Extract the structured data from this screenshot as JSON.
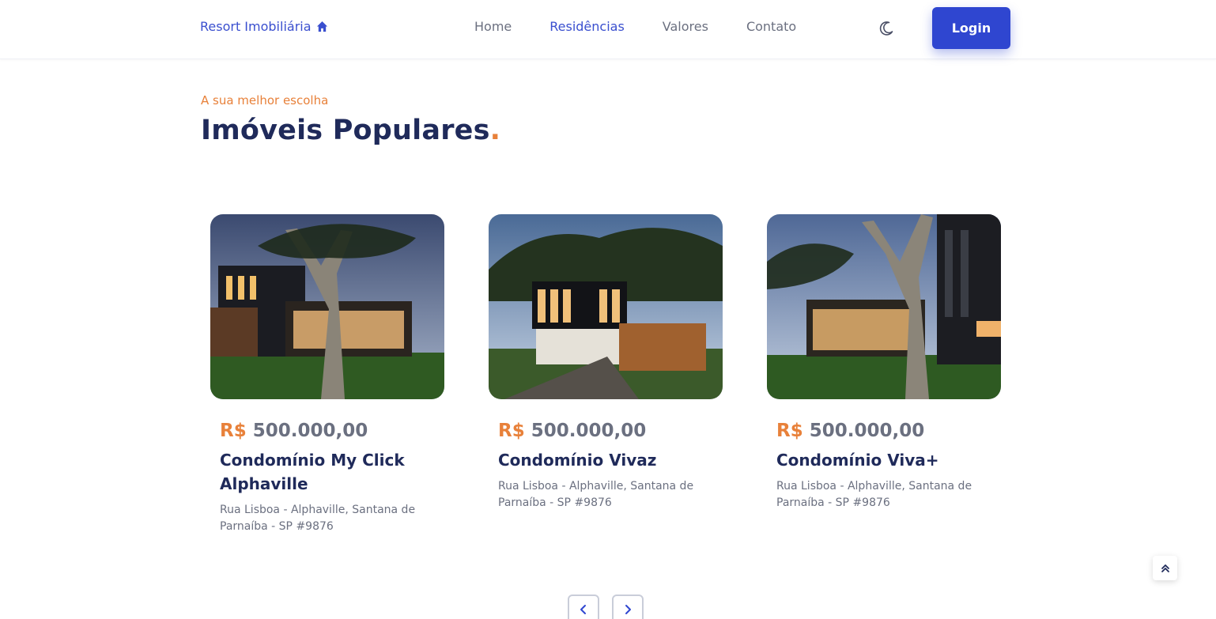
{
  "header": {
    "logo_text": "Resort Imobiliária",
    "nav": [
      {
        "label": "Home",
        "active": false
      },
      {
        "label": "Residências",
        "active": true
      },
      {
        "label": "Valores",
        "active": false
      },
      {
        "label": "Contato",
        "active": false
      }
    ],
    "theme_toggle_icon": "moon-icon",
    "login_label": "Login"
  },
  "section": {
    "subtitle": "A sua melhor escolha",
    "title": "Imóveis Populares",
    "title_dot": "."
  },
  "cards": [
    {
      "currency": "R$",
      "price": "500.000,00",
      "name": "Condomínio My Click Alphaville",
      "address": "Rua Lisboa - Alphaville, Santana de Parnaíba - SP #9876"
    },
    {
      "currency": "R$",
      "price": "500.000,00",
      "name": "Condomínio Vivaz",
      "address": "Rua Lisboa - Alphaville, Santana de Parnaíba - SP #9876"
    },
    {
      "currency": "R$",
      "price": "500.000,00",
      "name": "Condomínio Viva+",
      "address": "Rua Lisboa - Alphaville, Santana de Parnaíba - SP #9876"
    }
  ],
  "controls": {
    "prev_icon": "chevron-left-icon",
    "next_icon": "chevron-right-icon",
    "scroll_top_icon": "double-chevron-up-icon"
  },
  "colors": {
    "primary": "#2f46d0",
    "accent": "#e8813a",
    "heading": "#1f2a5a",
    "muted": "#6b7080"
  }
}
